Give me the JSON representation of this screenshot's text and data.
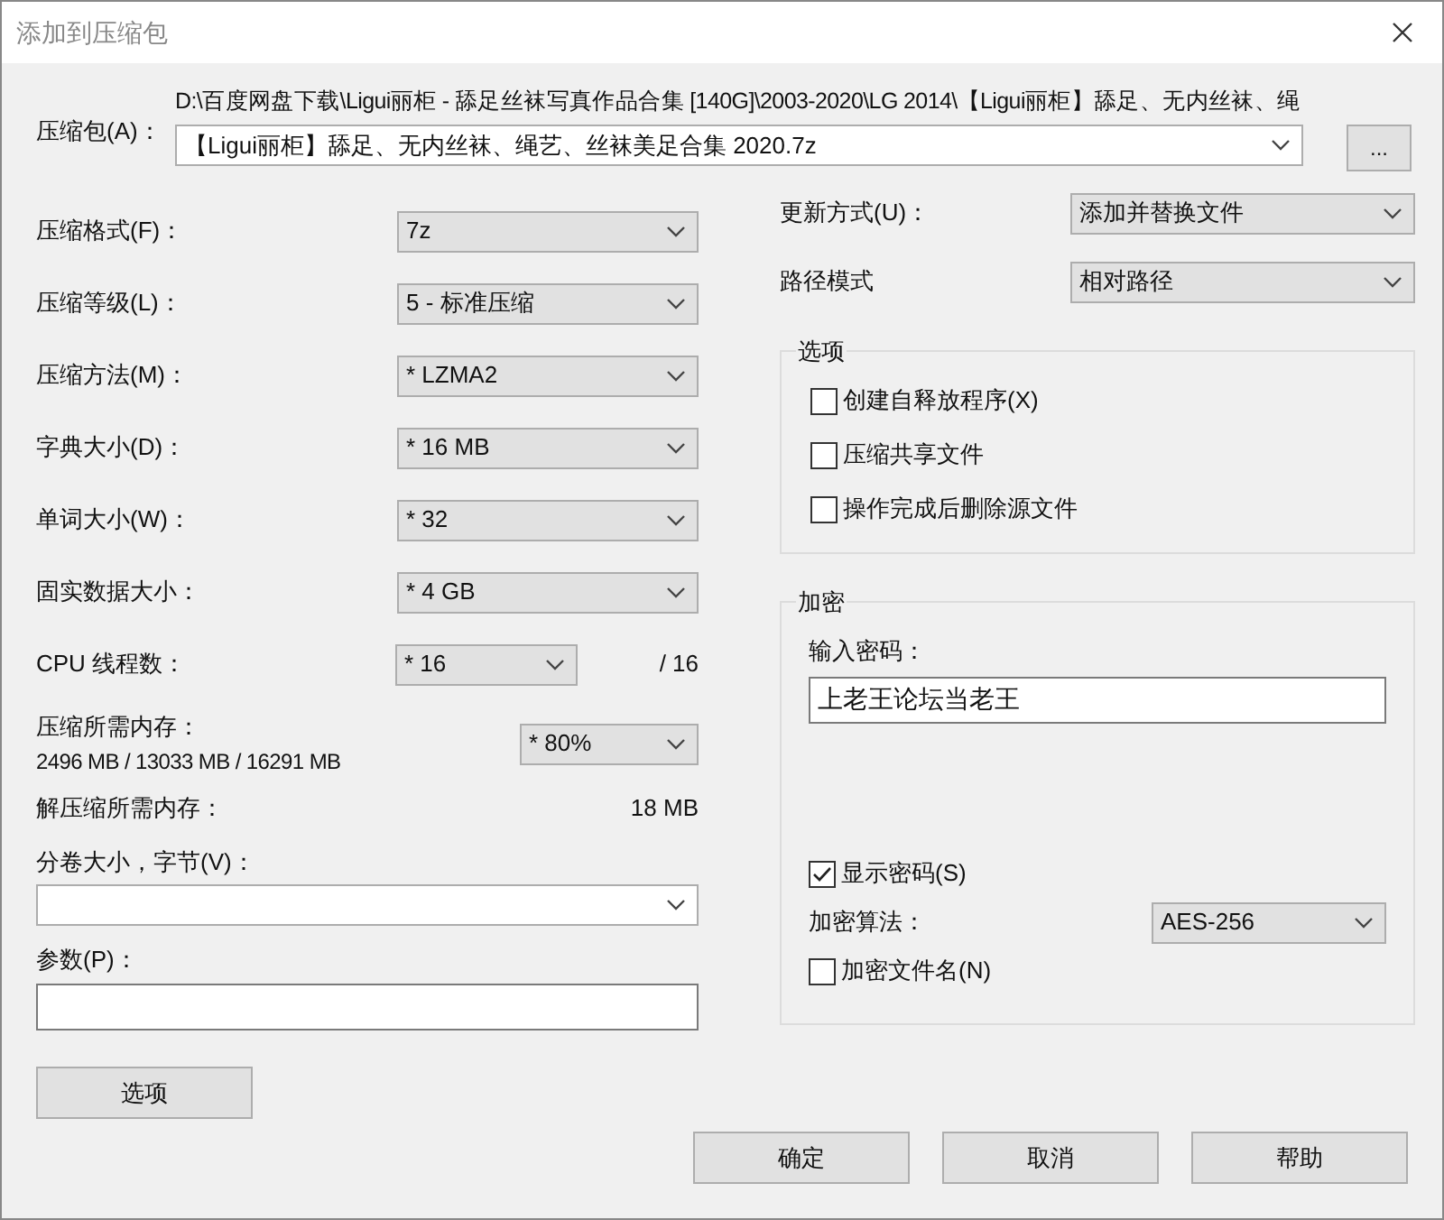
{
  "window": {
    "title": "添加到压缩包"
  },
  "archive": {
    "label": "压缩包(A)：",
    "path": "D:\\百度网盘下载\\Ligui丽柜 - 舔足丝袜写真作品合集 [140G]\\2003-2020\\LG 2014\\【Ligui丽柜】舔足、无内丝袜、绳",
    "value": "【Ligui丽柜】舔足、无内丝袜、绳艺、丝袜美足合集 2020.7z",
    "browse": "..."
  },
  "settings": [
    {
      "label": "压缩格式(F)：",
      "value": "7z"
    },
    {
      "label": "压缩等级(L)：",
      "value": "5 - 标准压缩"
    },
    {
      "label": "压缩方法(M)：",
      "value": "* LZMA2"
    },
    {
      "label": "字典大小(D)：",
      "value": "* 16 MB"
    },
    {
      "label": "单词大小(W)：",
      "value": "* 32"
    },
    {
      "label": "固实数据大小：",
      "value": "* 4 GB"
    }
  ],
  "cpu_threads": {
    "label": "CPU 线程数：",
    "value": "* 16",
    "total": "/ 16"
  },
  "memory": {
    "label": "压缩所需内存：",
    "detail": "2496 MB / 13033 MB / 16291 MB",
    "value": "* 80%"
  },
  "decompress_memory": {
    "label": "解压缩所需内存：",
    "value": "18 MB"
  },
  "volume_size": {
    "label": "分卷大小，字节(V)："
  },
  "parameters": {
    "label": "参数(P)："
  },
  "options_button": "选项",
  "update_mode": {
    "label": "更新方式(U)：",
    "value": "添加并替换文件"
  },
  "path_mode": {
    "label": "路径模式",
    "value": "相对路径"
  },
  "options_group": {
    "title": "选项",
    "checkboxes": [
      {
        "label": "创建自释放程序(X)",
        "checked": false
      },
      {
        "label": "压缩共享文件",
        "checked": false
      },
      {
        "label": "操作完成后删除源文件",
        "checked": false
      }
    ]
  },
  "encryption": {
    "title": "加密",
    "password_label": "输入密码：",
    "password": "上老王论坛当老王",
    "show_password": {
      "label": "显示密码(S)",
      "checked": true
    },
    "algorithm": {
      "label": "加密算法：",
      "value": "AES-256"
    },
    "encrypt_names": {
      "label": "加密文件名(N)",
      "checked": false
    }
  },
  "buttons": [
    "确定",
    "取消",
    "帮助"
  ]
}
